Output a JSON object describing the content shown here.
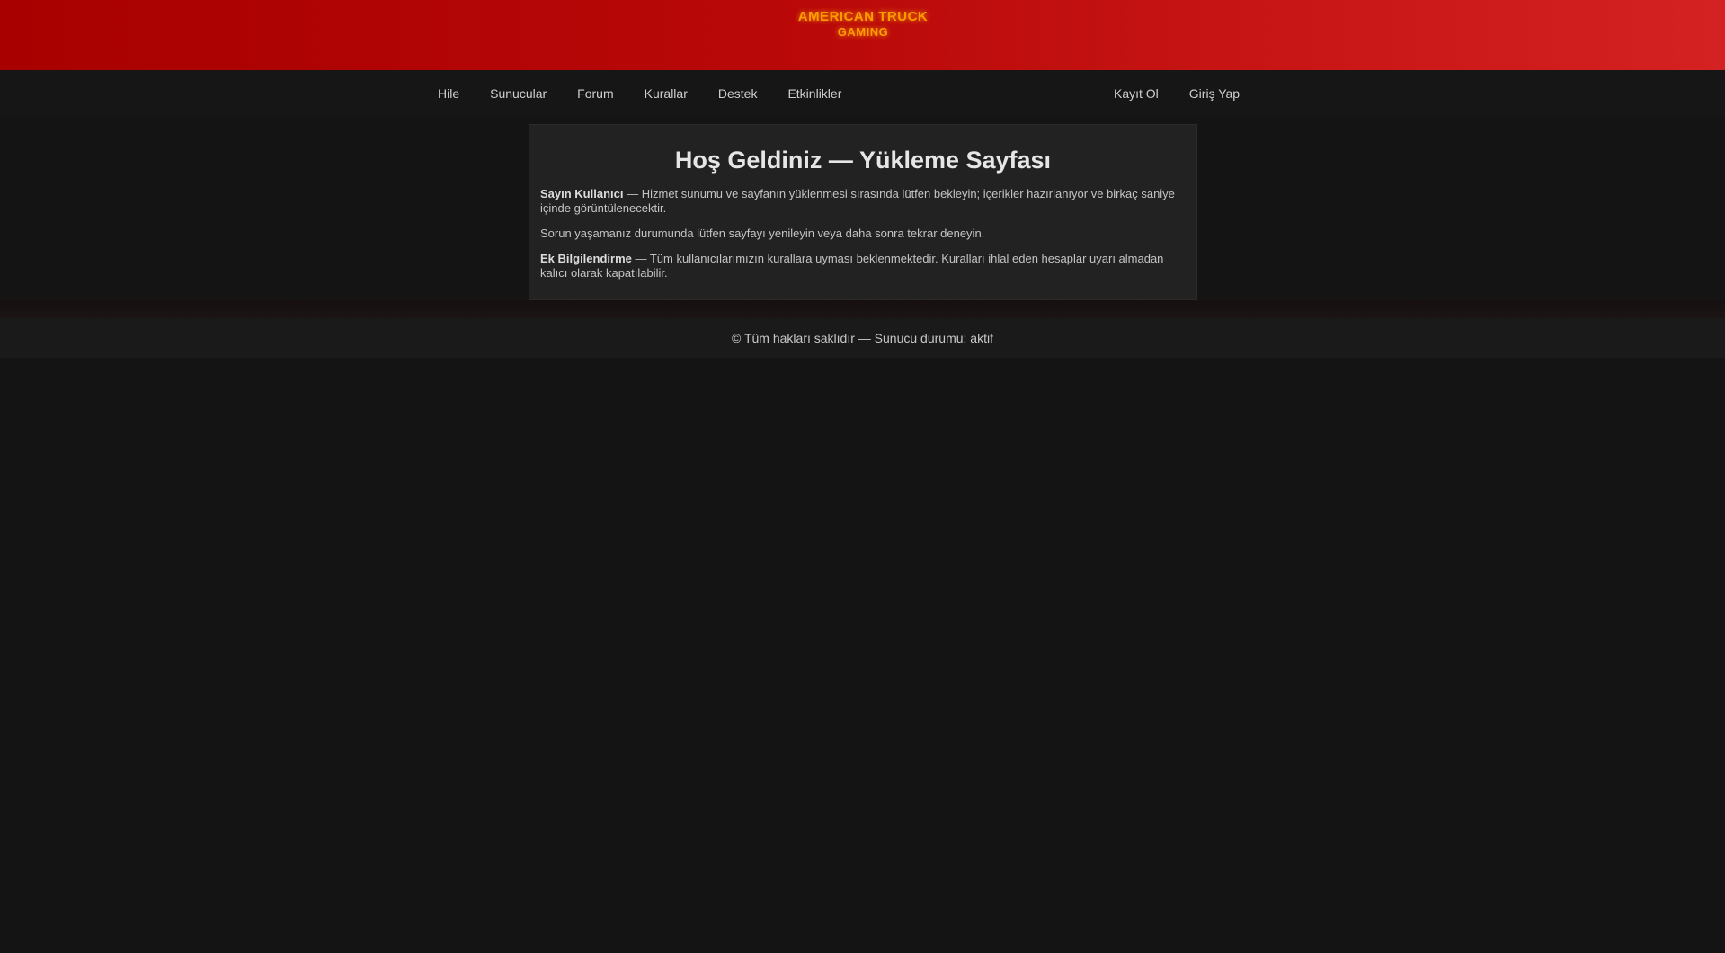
{
  "header": {
    "logo_line1": "AMERICAN TRUCK",
    "logo_line2": "GAMING"
  },
  "nav": {
    "left_items": [
      {
        "label": "Hile"
      },
      {
        "label": "Sunucular"
      },
      {
        "label": "Forum"
      },
      {
        "label": "Kurallar"
      },
      {
        "label": "Destek"
      },
      {
        "label": "Etkinlikler"
      }
    ],
    "right_items": [
      {
        "label": "Kayıt Ol"
      },
      {
        "label": "Giriş Yap"
      }
    ]
  },
  "panel": {
    "title": "Hoş Geldiniz — Yükleme Sayfası",
    "paragraph1_bold": "Sayın Kullanıcı",
    "paragraph1_text": " — Hizmet sunumu ve sayfanın yüklenmesi sırasında lütfen bekleyin; içerikler hazırlanıyor ve birkaç saniye içinde görüntülenecektir.",
    "paragraph2_text": "Sorun yaşamanız durumunda lütfen sayfayı yenileyin veya daha sonra tekrar deneyin.",
    "paragraph3_bold": "Ek Bilgilendirme",
    "paragraph3_text": " — Tüm kullanıcılarımızın kurallara uyması beklenmektedir. Kuralları ihlal eden hesaplar uyarı almadan kalıcı olarak kapatılabilir."
  },
  "footer": {
    "text": "© Tüm hakları saklıdır — Sunucu durumu: aktif"
  },
  "colors": {
    "header_start": "#a80000",
    "header_end": "#d42222",
    "logo": "#ff9d00",
    "background": "#141414",
    "panel": "#222222"
  }
}
